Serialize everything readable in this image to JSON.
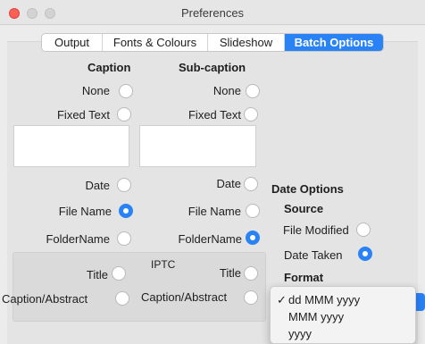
{
  "window": {
    "title": "Preferences"
  },
  "tabs": [
    {
      "label": "Output",
      "active": false
    },
    {
      "label": "Fonts & Colours",
      "active": false
    },
    {
      "label": "Slideshow",
      "active": false
    },
    {
      "label": "Batch Options",
      "active": true
    }
  ],
  "caption": {
    "heading": "Caption",
    "none": "None",
    "fixed_text": "Fixed Text",
    "fixed_text_value": "",
    "date": "Date",
    "file_name": "File Name",
    "folder_name": "FolderName",
    "selected": "file_name"
  },
  "subcaption": {
    "heading": "Sub-caption",
    "none": "None",
    "fixed_text": "Fixed Text",
    "fixed_text_value": "",
    "date": "Date",
    "file_name": "File Name",
    "folder_name": "FolderName",
    "selected": "folder_name"
  },
  "iptc": {
    "heading": "IPTC",
    "caption_title": "Title",
    "caption_abstract": "Caption/Abstract",
    "sub_title": "Title",
    "sub_abstract": "Caption/Abstract"
  },
  "date_options": {
    "heading": "Date Options",
    "source_heading": "Source",
    "file_modified": "File Modified",
    "date_taken": "Date Taken",
    "source_selected": "date_taken",
    "format_heading": "Format",
    "format_menu": [
      {
        "label": "dd MMM yyyy",
        "checked": true
      },
      {
        "label": "MMM yyyy",
        "checked": false
      },
      {
        "label": "yyyy",
        "checked": false
      }
    ],
    "check_glyph": "✓"
  },
  "colors": {
    "accent": "#2a82f7"
  }
}
